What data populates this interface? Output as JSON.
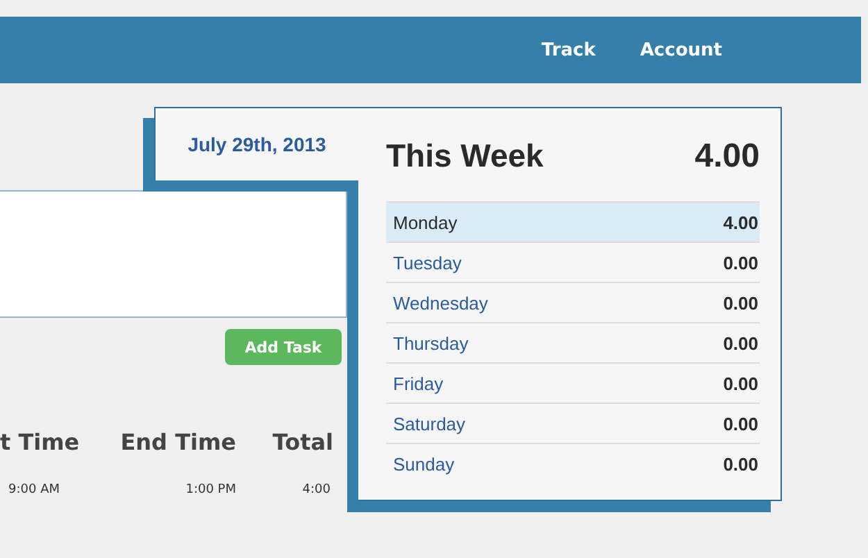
{
  "navbar": {
    "links": [
      "Track",
      "Account"
    ]
  },
  "task_form": {
    "button": "Add Task"
  },
  "tasks_table": {
    "columns": [
      "t Time",
      "End Time",
      "Total"
    ],
    "rows": [
      [
        "9:00 AM",
        "1:00 PM",
        "4:00"
      ]
    ]
  },
  "week_card": {
    "date": "July 29th, 2013",
    "title": "This Week",
    "total": "4.00",
    "days": [
      {
        "day": "Monday",
        "hours": "4.00",
        "selected": true
      },
      {
        "day": "Tuesday",
        "hours": "0.00",
        "selected": false
      },
      {
        "day": "Wednesday",
        "hours": "0.00",
        "selected": false
      },
      {
        "day": "Thursday",
        "hours": "0.00",
        "selected": false
      },
      {
        "day": "Friday",
        "hours": "0.00",
        "selected": false
      },
      {
        "day": "Saturday",
        "hours": "0.00",
        "selected": false
      },
      {
        "day": "Sunday",
        "hours": "0.00",
        "selected": false
      }
    ]
  }
}
